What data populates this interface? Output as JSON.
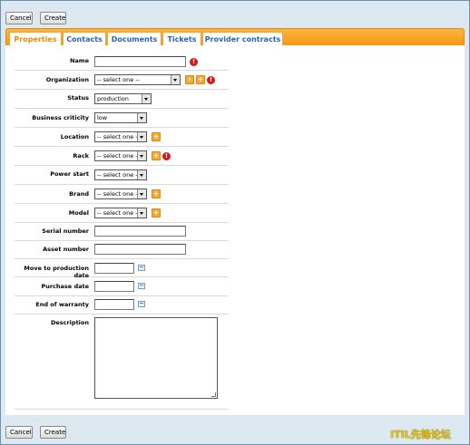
{
  "toolbar": {
    "cancel_label": "Cancel",
    "create_label": "Create"
  },
  "tabs": [
    {
      "label": "Properties",
      "active": true
    },
    {
      "label": "Contacts",
      "active": false
    },
    {
      "label": "Documents",
      "active": false
    },
    {
      "label": "Tickets",
      "active": false
    },
    {
      "label": "Provider contracts",
      "active": false
    }
  ],
  "form": {
    "name": {
      "label": "Name",
      "value": "",
      "required": true
    },
    "organization": {
      "label": "Organization",
      "value": "-- select one --",
      "required": true
    },
    "status": {
      "label": "Status",
      "value": "production"
    },
    "business_criticity": {
      "label": "Business criticity",
      "value": "low"
    },
    "location": {
      "label": "Location",
      "value": "-- select one --"
    },
    "rack": {
      "label": "Rack",
      "value": "-- select one --",
      "required": true
    },
    "power_start": {
      "label": "Power start",
      "value": "-- select one --"
    },
    "brand": {
      "label": "Brand",
      "value": "-- select one --"
    },
    "model": {
      "label": "Model",
      "value": "-- select one --"
    },
    "serial_number": {
      "label": "Serial number",
      "value": ""
    },
    "asset_number": {
      "label": "Asset number",
      "value": ""
    },
    "move_to_production_date": {
      "label": "Move to production date",
      "value": ""
    },
    "purchase_date": {
      "label": "Purchase date",
      "value": ""
    },
    "end_of_warranty": {
      "label": "End of warranty",
      "value": ""
    },
    "description": {
      "label": "Description",
      "value": ""
    }
  },
  "icons": {
    "add": "plus-icon",
    "search": "search-icon",
    "required": "exclamation-icon",
    "calendar": "calendar-icon"
  },
  "colors": {
    "accent_orange": "#f59a16",
    "tab_text": "#2b64b3",
    "active_tab_text": "#f08a00",
    "required_red": "#d21a1a"
  },
  "watermark": "ITIL先锋论坛"
}
